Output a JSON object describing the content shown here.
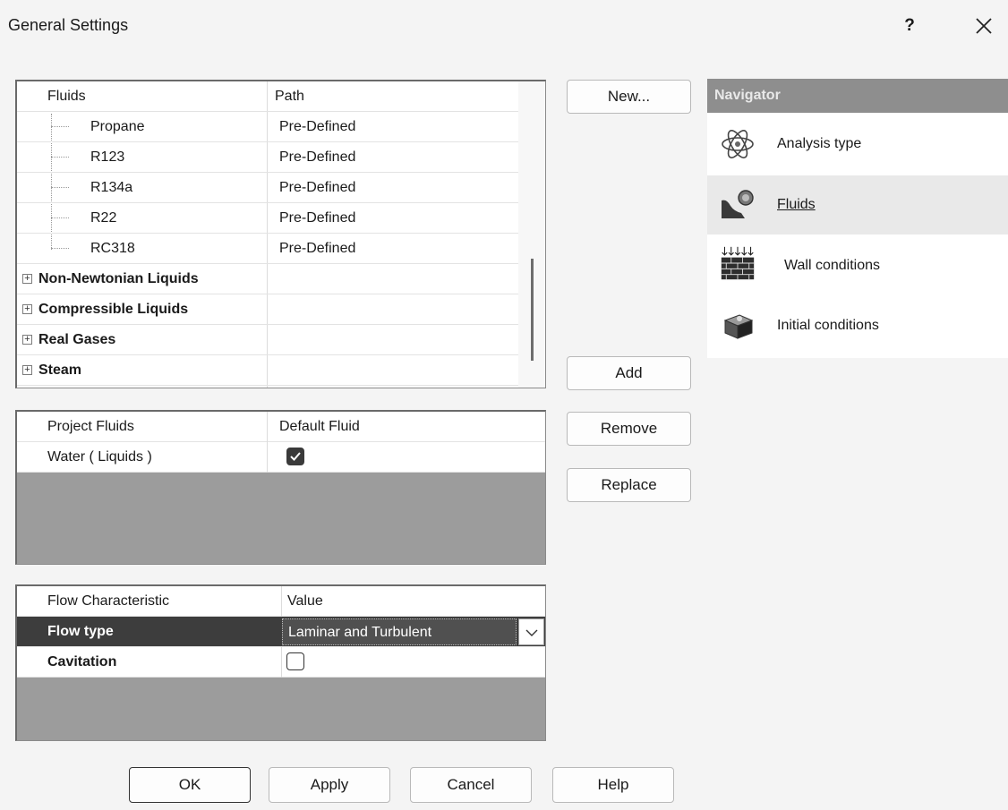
{
  "window": {
    "title": "General Settings",
    "help_label": "?",
    "close_icon": "close-icon"
  },
  "fluids_grid": {
    "headers": {
      "name": "Fluids",
      "path": "Path"
    },
    "items": [
      {
        "name": "Propane",
        "path": "Pre-Defined"
      },
      {
        "name": "R123",
        "path": "Pre-Defined"
      },
      {
        "name": "R134a",
        "path": "Pre-Defined"
      },
      {
        "name": "R22",
        "path": "Pre-Defined"
      },
      {
        "name": "RC318",
        "path": "Pre-Defined"
      }
    ],
    "groups": [
      {
        "name": "Non-Newtonian Liquids",
        "expander": "+"
      },
      {
        "name": "Compressible Liquids",
        "expander": "+"
      },
      {
        "name": "Real Gases",
        "expander": "+"
      },
      {
        "name": "Steam",
        "expander": "+"
      }
    ]
  },
  "project_fluids": {
    "headers": {
      "name": "Project Fluids",
      "default": "Default Fluid"
    },
    "rows": [
      {
        "name": "Water ( Liquids )",
        "default_checked": true
      }
    ]
  },
  "flow_grid": {
    "headers": {
      "name": "Flow Characteristic",
      "value": "Value"
    },
    "rows": [
      {
        "name": "Flow type",
        "value": "Laminar and Turbulent",
        "selected": true
      },
      {
        "name": "Cavitation",
        "checked": false
      }
    ]
  },
  "side_buttons": {
    "new": "New...",
    "add": "Add",
    "remove": "Remove",
    "replace": "Replace"
  },
  "navigator": {
    "title": "Navigator",
    "items": [
      {
        "label": "Analysis type",
        "icon": "analysis-type-icon",
        "active": false
      },
      {
        "label": "Fluids",
        "icon": "fluids-icon",
        "active": true
      },
      {
        "label": "Wall conditions",
        "icon": "wall-conditions-icon",
        "active": false
      },
      {
        "label": "Initial conditions",
        "icon": "initial-conditions-icon",
        "active": false
      }
    ]
  },
  "bottom_buttons": {
    "ok": "OK",
    "apply": "Apply",
    "cancel": "Cancel",
    "help": "Help"
  },
  "colors": {
    "selected_row": "#3d3d3d",
    "navigator_header": "#8e8e8e",
    "empty_grid_area": "#9c9c9c"
  }
}
